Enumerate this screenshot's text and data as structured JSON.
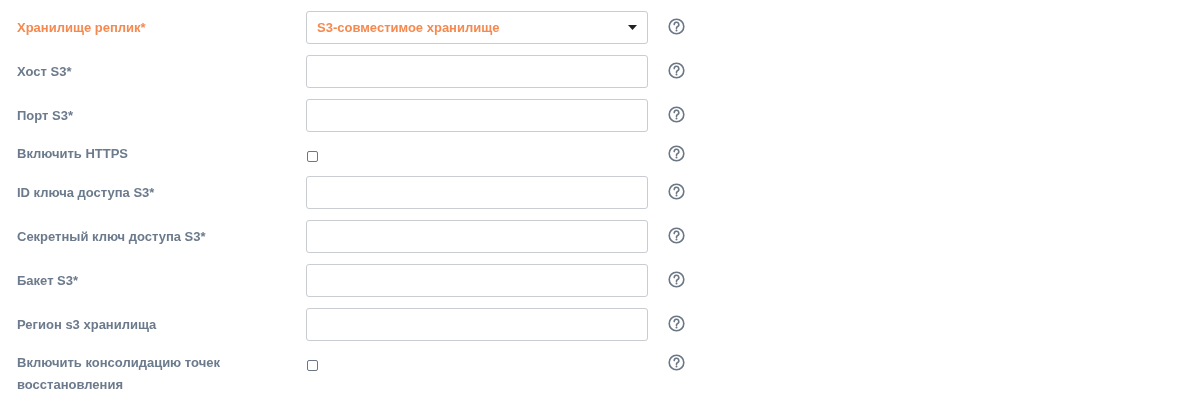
{
  "fields": [
    {
      "kind": "select",
      "label": "Хранилище реплик*",
      "highlighted": true,
      "value": "S3-совместимое хранилище"
    },
    {
      "kind": "text",
      "label": "Хост S3*",
      "highlighted": false
    },
    {
      "kind": "text",
      "label": "Порт S3*",
      "highlighted": false
    },
    {
      "kind": "checkbox",
      "label": "Включить HTTPS",
      "highlighted": false,
      "checked": false
    },
    {
      "kind": "text",
      "label": "ID ключа доступа S3*",
      "highlighted": false
    },
    {
      "kind": "text",
      "label": "Секретный ключ доступа S3*",
      "highlighted": false
    },
    {
      "kind": "text",
      "label": "Бакет S3*",
      "highlighted": false
    },
    {
      "kind": "text",
      "label": "Регион s3 хранилища",
      "highlighted": false
    },
    {
      "kind": "checkbox",
      "label": "Включить консолидацию точек восстановления",
      "highlighted": false,
      "checked": false
    }
  ]
}
